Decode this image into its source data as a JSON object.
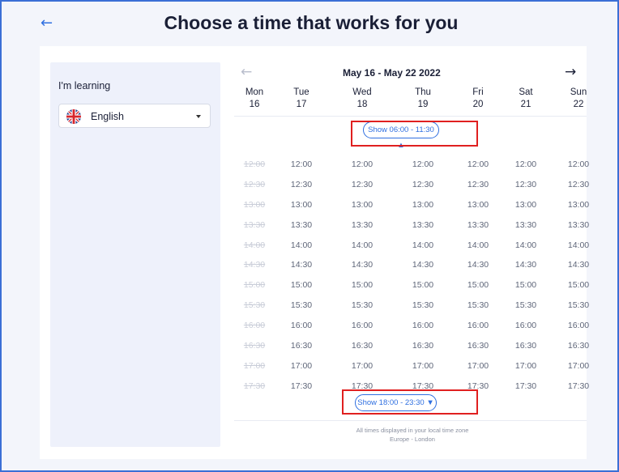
{
  "header": {
    "title": "Choose a time that works for you",
    "back_icon": "arrow-left-icon"
  },
  "sidebar": {
    "label": "I'm learning",
    "language": {
      "value": "English",
      "flag_icon": "uk-flag-icon"
    }
  },
  "calendar": {
    "range": "May 16 - May 22 2022",
    "prev_icon": "arrow-left-icon",
    "next_icon": "arrow-right-icon",
    "days": [
      {
        "name": "Mon",
        "date": "16"
      },
      {
        "name": "Tue",
        "date": "17"
      },
      {
        "name": "Wed",
        "date": "18"
      },
      {
        "name": "Thu",
        "date": "19"
      },
      {
        "name": "Fri",
        "date": "20"
      },
      {
        "name": "Sat",
        "date": "21"
      },
      {
        "name": "Sun",
        "date": "22"
      }
    ],
    "show_earlier": "Show 06:00 - 11:30 ▲",
    "show_later": "Show 18:00 - 23:30 ▼",
    "times": [
      "12:00",
      "12:30",
      "13:00",
      "13:30",
      "14:00",
      "14:30",
      "15:00",
      "15:30",
      "16:00",
      "16:30",
      "17:00",
      "17:30"
    ],
    "unavailable_day_index": 0,
    "timezone_line1": "All times displayed in your local time zone",
    "timezone_line2": "Europe - London"
  },
  "colors": {
    "accent": "#2f6fe0",
    "highlight": "#e02020",
    "sidebar_bg": "#eef1fb"
  }
}
